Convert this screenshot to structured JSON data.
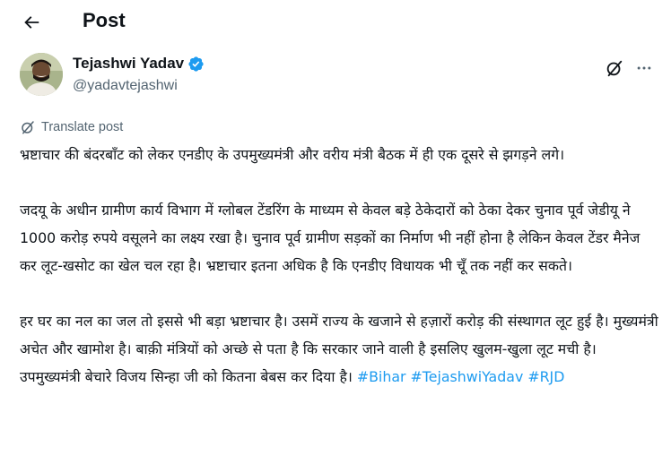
{
  "header": {
    "title": "Post",
    "back_icon": "arrow-left-icon"
  },
  "author": {
    "display_name": "Tejashwi Yadav",
    "handle": "@yadavtejashwi",
    "verified_color": "#1d9bf0"
  },
  "actions": {
    "grok_icon": "grok-icon",
    "more_icon": "more-horizontal-icon"
  },
  "translate": {
    "label": "Translate post"
  },
  "post": {
    "paragraph1": "भ्रष्टाचार की बंदरबाँट को लेकर एनडीए के उपमुख्यमंत्री और वरीय मंत्री बैठक में ही एक दूसरे से झगड़ने लगे।",
    "paragraph2": "जदयू के अधीन ग्रामीण कार्य विभाग में ग्लोबल टेंडरिंग के माध्यम से केवल बड़े ठेकेदारों को ठेका देकर चुनाव पूर्व जेडीयू ने 1000 करोड़ रुपये वसूलने का लक्ष्य रखा है। चुनाव पूर्व ग्रामीण सड़कों का निर्माण भी नहीं होना है लेकिन केवल टेंडर मैनेज कर लूट-खसोट का खेल चल रहा है। भ्रष्टाचार इतना अधिक है कि एनडीए विधायक भी चूँ तक नहीं कर सकते।",
    "paragraph3": "हर घर का नल का जल तो इससे भी बड़ा भ्रष्टाचार है। उसमें राज्य के खजाने से हज़ारों करोड़ की संस्थागत लूट हुई है। मुख्यमंत्री अचेत और खामोश है। बाक़ी मंत्रियों को अच्छे से पता है कि सरकार जाने वाली है इसलिए खुलम-खुला लूट मची है। उपमुख्यमंत्री बेचारे विजय सिन्हा जी को कितना बेबस कर दिया है।",
    "hashtags": [
      "#Bihar",
      "#TejashwiYadav",
      "#RJD"
    ],
    "hashtag_color": "#1d9bf0"
  }
}
